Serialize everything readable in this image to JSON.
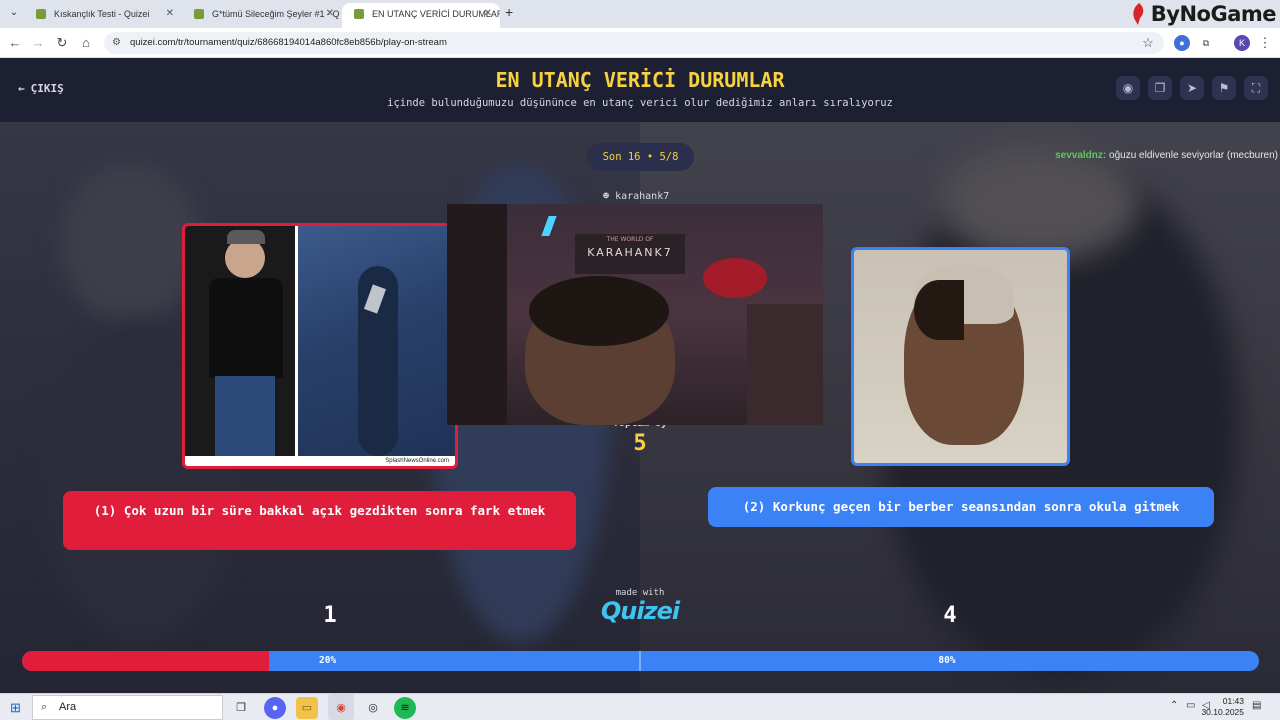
{
  "browser": {
    "tabs": [
      {
        "title": "Kıskançlık Testi - Quizei",
        "active": false
      },
      {
        "title": "G*tümü Sileceğim Şeyler #1 - Q",
        "active": false
      },
      {
        "title": "EN UTANÇ VERİCİ DURUMLAR",
        "active": true
      }
    ],
    "new_tab": "+",
    "url": "quizei.com/tr/tournament/quiz/68668194014a860fc8eb856b/play-on-stream",
    "profile_initial": "K",
    "brand": "ByNoGame"
  },
  "quiz": {
    "exit_label": "ÇIKIŞ",
    "title": "EN UTANÇ VERİCİ DURUMLAR",
    "subtitle": "içinde bulunduğumuzu düşününce en utanç verici olur dediğimiz anları sıralıyoruz",
    "round": "Son 16 • 5/8",
    "streamer": "karahank7",
    "total_label": "Toplam oy",
    "total_votes": "5",
    "made_with": "made with",
    "logo": "Quizei",
    "webcam_sign_top": "THE WORLD OF",
    "webcam_sign": "KARAHANK7",
    "image_caption": "SplashNewsOnline.com"
  },
  "chat": {
    "user": "sevvaldnz:",
    "message": "oğuzu eldivenle seviyorlar (mecburen)"
  },
  "options": {
    "left": {
      "label": "(1) Çok uzun bir süre bakkal açık gezdikten sonra fark etmek",
      "votes": "1",
      "percent": "20%",
      "share": 0.2
    },
    "right": {
      "label": "(2) Korkunç geçen bir berber seansından sonra okula gitmek",
      "votes": "4",
      "percent": "80%",
      "share": 0.8
    }
  },
  "colors": {
    "left": "#e01e3c",
    "right": "#3b82f6",
    "accent": "#f6d23f"
  },
  "taskbar": {
    "search_placeholder": "Ara",
    "time": "01:43",
    "date": "30.10.2025"
  }
}
